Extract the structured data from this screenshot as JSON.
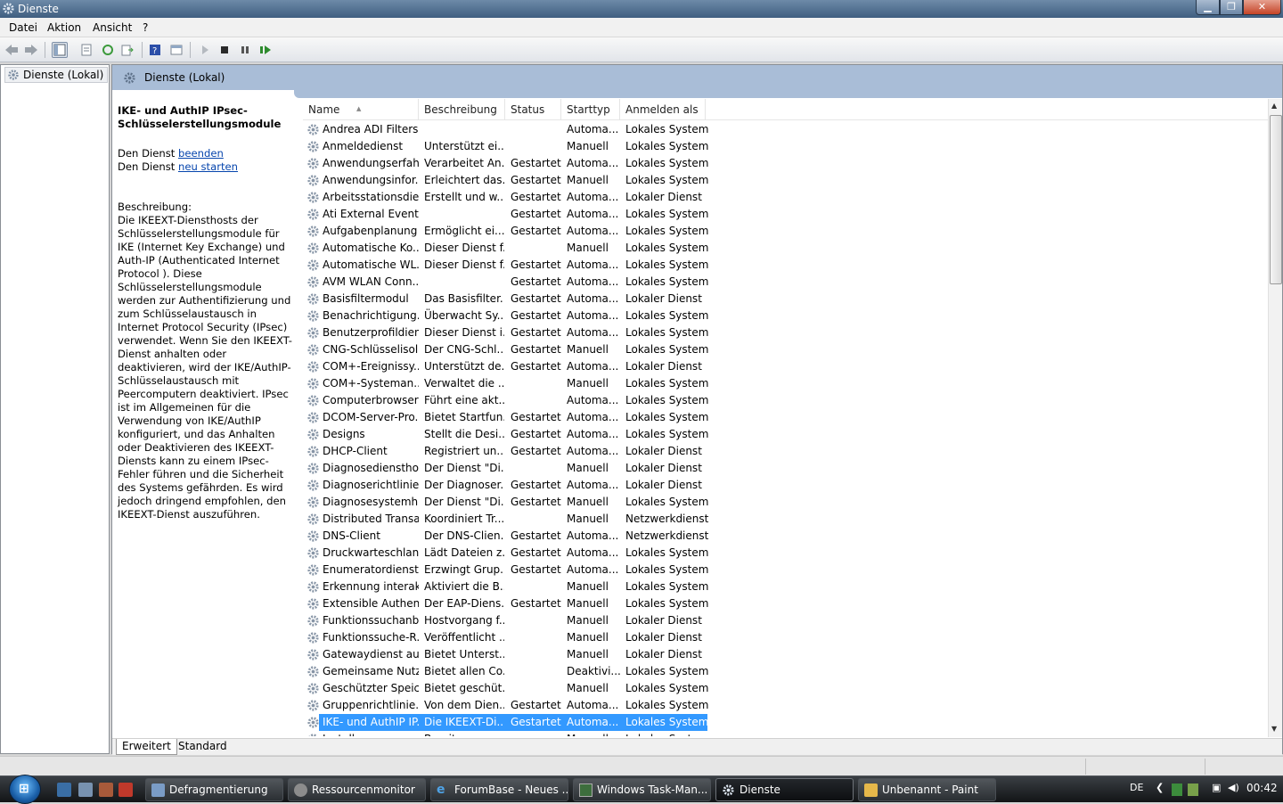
{
  "window": {
    "title": "Dienste"
  },
  "menu": [
    "Datei",
    "Aktion",
    "Ansicht",
    "?"
  ],
  "tree": {
    "root": "Dienste (Lokal)"
  },
  "panel": {
    "header": "Dienste (Lokal)",
    "service_title": "IKE- und AuthIP IPsec-Schlüsselerstellungsmodule",
    "action1_prefix": "Den Dienst ",
    "action1_link": "beenden",
    "action2_prefix": "Den Dienst ",
    "action2_link": "neu starten",
    "description_label": "Beschreibung:",
    "description": "Die IKEEXT-Diensthosts der Schlüsselerstellungsmodule für IKE (Internet Key Exchange) und Auth-IP (Authenticated Internet Protocol ). Diese Schlüsselerstellungsmodule werden zur Authentifizierung und zum Schlüsselaustausch in Internet Protocol Security (IPsec) verwendet. Wenn Sie den IKEEXT-Dienst anhalten oder deaktivieren, wird der IKE/AuthIP-Schlüsselaustausch mit Peercomputern deaktiviert. IPsec ist im Allgemeinen für die Verwendung von IKE/AuthIP konfiguriert, und das Anhalten oder Deaktivieren des IKEEXT-Diensts kann zu einem IPsec-Fehler führen und die Sicherheit des Systems gefährden. Es wird jedoch dringend empfohlen, den IKEEXT-Dienst auszuführen."
  },
  "columns": [
    "Name",
    "Beschreibung",
    "Status",
    "Starttyp",
    "Anmelden als"
  ],
  "services": [
    [
      "Andrea ADI Filters ...",
      "",
      "",
      "Automa...",
      "Lokales System"
    ],
    [
      "Anmeldedienst",
      "Unterstützt ei...",
      "",
      "Manuell",
      "Lokales System"
    ],
    [
      "Anwendungserfah...",
      "Verarbeitet An...",
      "Gestartet",
      "Automa...",
      "Lokales System"
    ],
    [
      "Anwendungsinfor...",
      "Erleichtert das...",
      "Gestartet",
      "Manuell",
      "Lokales System"
    ],
    [
      "Arbeitsstationsdie...",
      "Erstellt und w...",
      "Gestartet",
      "Automa...",
      "Lokaler Dienst"
    ],
    [
      "Ati External Event ...",
      "",
      "Gestartet",
      "Automa...",
      "Lokales System"
    ],
    [
      "Aufgabenplanung",
      "Ermöglicht ei...",
      "Gestartet",
      "Automa...",
      "Lokales System"
    ],
    [
      "Automatische Ko...",
      "Dieser Dienst f...",
      "",
      "Manuell",
      "Lokales System"
    ],
    [
      "Automatische WL...",
      "Dieser Dienst f...",
      "Gestartet",
      "Automa...",
      "Lokales System"
    ],
    [
      "AVM WLAN Conn...",
      "",
      "Gestartet",
      "Automa...",
      "Lokales System"
    ],
    [
      "Basisfiltermodul",
      "Das Basisfilter...",
      "Gestartet",
      "Automa...",
      "Lokaler Dienst"
    ],
    [
      "Benachrichtigung...",
      "Überwacht Sy...",
      "Gestartet",
      "Automa...",
      "Lokales System"
    ],
    [
      "Benutzerprofildienst",
      "Dieser Dienst i...",
      "Gestartet",
      "Automa...",
      "Lokales System"
    ],
    [
      "CNG-Schlüsselisol...",
      "Der CNG-Schl...",
      "Gestartet",
      "Manuell",
      "Lokales System"
    ],
    [
      "COM+-Ereignissy...",
      "Unterstützt de...",
      "Gestartet",
      "Automa...",
      "Lokaler Dienst"
    ],
    [
      "COM+-Systeman...",
      "Verwaltet die ...",
      "",
      "Manuell",
      "Lokales System"
    ],
    [
      "Computerbrowser",
      "Führt eine akt...",
      "",
      "Automa...",
      "Lokales System"
    ],
    [
      "DCOM-Server-Pro...",
      "Bietet Startfun...",
      "Gestartet",
      "Automa...",
      "Lokales System"
    ],
    [
      "Designs",
      "Stellt die Desi...",
      "Gestartet",
      "Automa...",
      "Lokales System"
    ],
    [
      "DHCP-Client",
      "Registriert un...",
      "Gestartet",
      "Automa...",
      "Lokaler Dienst"
    ],
    [
      "Diagnosediensthost",
      "Der Dienst \"Di...",
      "",
      "Manuell",
      "Lokaler Dienst"
    ],
    [
      "Diagnoserichtlinie...",
      "Der Diagnoser...",
      "Gestartet",
      "Automa...",
      "Lokaler Dienst"
    ],
    [
      "Diagnosesystemh...",
      "Der Dienst \"Di...",
      "Gestartet",
      "Manuell",
      "Lokales System"
    ],
    [
      "Distributed Transa...",
      "Koordiniert Tr...",
      "",
      "Manuell",
      "Netzwerkdienst"
    ],
    [
      "DNS-Client",
      "Der DNS-Clien...",
      "Gestartet",
      "Automa...",
      "Netzwerkdienst"
    ],
    [
      "Druckwarteschlan...",
      "Lädt Dateien z...",
      "Gestartet",
      "Automa...",
      "Lokales System"
    ],
    [
      "Enumeratordienst ...",
      "Erzwingt Grup...",
      "Gestartet",
      "Automa...",
      "Lokales System"
    ],
    [
      "Erkennung interak...",
      "Aktiviert die B...",
      "",
      "Manuell",
      "Lokales System"
    ],
    [
      "Extensible Authen...",
      "Der EAP-Diens...",
      "Gestartet",
      "Manuell",
      "Lokales System"
    ],
    [
      "Funktionssuchanb...",
      "Hostvorgang f...",
      "",
      "Manuell",
      "Lokaler Dienst"
    ],
    [
      "Funktionssuche-R...",
      "Veröffentlicht ...",
      "",
      "Manuell",
      "Lokaler Dienst"
    ],
    [
      "Gatewaydienst auf...",
      "Bietet Unterst...",
      "",
      "Manuell",
      "Lokaler Dienst"
    ],
    [
      "Gemeinsame Nutz...",
      "Bietet allen Co...",
      "",
      "Deaktivi...",
      "Lokales System"
    ],
    [
      "Geschützter Speic...",
      "Bietet geschüt...",
      "",
      "Manuell",
      "Lokales System"
    ],
    [
      "Gruppenrichtlinie...",
      "Von dem Dien...",
      "Gestartet",
      "Automa...",
      "Lokales System"
    ],
    [
      "IKE- und AuthIP IP...",
      "Die IKEEXT-Di...",
      "Gestartet",
      "Automa...",
      "Lokales System"
    ],
    [
      "Install...",
      "Bereit...",
      "",
      "Manuell",
      "Lokales System"
    ]
  ],
  "selected_index": 35,
  "tabs": [
    "Erweitert",
    "Standard"
  ],
  "taskbar": {
    "buttons": [
      "Defragmentierung",
      "Ressourcenmonitor",
      "ForumBase - Neues ...",
      "Windows Task-Man...",
      "Dienste",
      "Unbenannt - Paint"
    ],
    "lang": "DE",
    "clock": "00:42"
  },
  "colors": {
    "selection": "#3399ff",
    "panel_header": "#a9bdd7",
    "link": "#0645ad"
  }
}
